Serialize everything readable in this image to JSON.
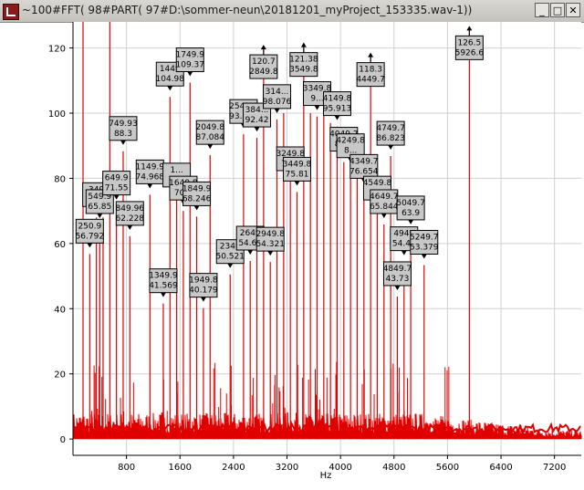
{
  "window": {
    "title": "~100#FFT( 98#PART( 97#D:\\sommer-neun\\20181201_myProject_153335.wav-1))",
    "minimize_glyph": "_",
    "maximize_glyph": "□",
    "close_glyph": "✕"
  },
  "colors": {
    "signal": "#e00000",
    "grid": "#d0d0d0",
    "label_bg": "#c8c8c8"
  },
  "chart_data": {
    "type": "line",
    "xlabel": "Hz",
    "ylabel": "",
    "xlim": [
      0,
      7600
    ],
    "ylim": [
      -5,
      128
    ],
    "xticks": [
      800,
      1600,
      2400,
      3200,
      4000,
      4800,
      5600,
      6400,
      7200
    ],
    "yticks": [
      0,
      20,
      40,
      60,
      80,
      100,
      120
    ],
    "grid": true,
    "noise_floor_db": 8,
    "peaks": [
      {
        "x": 150,
        "y": 128
      },
      {
        "x": 250,
        "y": 56.792
      },
      {
        "x": 350,
        "y": 68
      },
      {
        "x": 400,
        "y": 65.85
      },
      {
        "x": 450,
        "y": 68
      },
      {
        "x": 550,
        "y": 128
      },
      {
        "x": 650,
        "y": 71.55
      },
      {
        "x": 750,
        "y": 88.3
      },
      {
        "x": 850,
        "y": 62.228
      },
      {
        "x": 1150,
        "y": 74.968
      },
      {
        "x": 1350,
        "y": 41.569
      },
      {
        "x": 1450,
        "y": 104.98
      },
      {
        "x": 1550,
        "y": 74
      },
      {
        "x": 1650,
        "y": 70
      },
      {
        "x": 1750,
        "y": 109.37
      },
      {
        "x": 1850,
        "y": 68.246
      },
      {
        "x": 1950,
        "y": 40.179
      },
      {
        "x": 2050,
        "y": 87.084
      },
      {
        "x": 2350,
        "y": 50.521
      },
      {
        "x": 2550,
        "y": 93.519
      },
      {
        "x": 2650,
        "y": 54.64
      },
      {
        "x": 2750,
        "y": 92.42
      },
      {
        "x": 2850,
        "y": 120.7
      },
      {
        "x": 2950,
        "y": 54.321
      },
      {
        "x": 3050,
        "y": 98.076
      },
      {
        "x": 3150,
        "y": 100
      },
      {
        "x": 3250,
        "y": 79
      },
      {
        "x": 3350,
        "y": 75.81
      },
      {
        "x": 3450,
        "y": 121.38
      },
      {
        "x": 3550,
        "y": 100
      },
      {
        "x": 3650,
        "y": 99
      },
      {
        "x": 3750,
        "y": 101
      },
      {
        "x": 3850,
        "y": 97
      },
      {
        "x": 3950,
        "y": 95.913
      },
      {
        "x": 4050,
        "y": 85
      },
      {
        "x": 4150,
        "y": 83
      },
      {
        "x": 4250,
        "y": 80
      },
      {
        "x": 4350,
        "y": 76.654
      },
      {
        "x": 4450,
        "y": 118.3
      },
      {
        "x": 4550,
        "y": 70
      },
      {
        "x": 4650,
        "y": 65.844
      },
      {
        "x": 4750,
        "y": 86.823
      },
      {
        "x": 4850,
        "y": 43.73
      },
      {
        "x": 4950,
        "y": 54.46
      },
      {
        "x": 5050,
        "y": 63.9
      },
      {
        "x": 5250,
        "y": 53.379
      },
      {
        "x": 5926.6,
        "y": 126.5
      }
    ],
    "annotations": [
      {
        "x": 250,
        "y": 56.792,
        "lines": [
          "250.9",
          "56.792"
        ]
      },
      {
        "x": 350,
        "y": 68,
        "lines": [
          "349",
          "66"
        ]
      },
      {
        "x": 400,
        "y": 65.85,
        "lines": [
          "549.9",
          "65.85"
        ]
      },
      {
        "x": 650,
        "y": 71.55,
        "lines": [
          "649.9",
          "71.55"
        ]
      },
      {
        "x": 750,
        "y": 88.3,
        "lines": [
          "749.93",
          "88.3"
        ]
      },
      {
        "x": 850,
        "y": 62.228,
        "lines": [
          "849.96",
          "62.228"
        ]
      },
      {
        "x": 1150,
        "y": 74.968,
        "lines": [
          "1149.9",
          "74.968"
        ]
      },
      {
        "x": 1350,
        "y": 41.569,
        "lines": [
          "1349.9",
          "41.569"
        ]
      },
      {
        "x": 1450,
        "y": 104.98,
        "lines": [
          "1449",
          "104.98"
        ]
      },
      {
        "x": 1550,
        "y": 74,
        "lines": [
          "1...",
          "7..."
        ]
      },
      {
        "x": 1650,
        "y": 70,
        "lines": [
          "1649.8",
          "70..."
        ]
      },
      {
        "x": 1750,
        "y": 109.37,
        "lines": [
          "1749.9",
          "109.37"
        ]
      },
      {
        "x": 1850,
        "y": 68.246,
        "lines": [
          "1849.9",
          "68.246"
        ]
      },
      {
        "x": 1950,
        "y": 40.179,
        "lines": [
          "1949.8",
          "40.179"
        ]
      },
      {
        "x": 2050,
        "y": 87.084,
        "lines": [
          "2049.8",
          "87.084"
        ]
      },
      {
        "x": 2350,
        "y": 50.521,
        "lines": [
          "2349",
          "50.521"
        ]
      },
      {
        "x": 2550,
        "y": 93.519,
        "lines": [
          "2549.9",
          "93.519"
        ]
      },
      {
        "x": 2650,
        "y": 54.64,
        "lines": [
          "2649",
          "54.64"
        ]
      },
      {
        "x": 2750,
        "y": 92.42,
        "lines": [
          "384...",
          "92.42"
        ]
      },
      {
        "x": 2850,
        "y": 120.7,
        "lines": [
          "120.7",
          "2849.8"
        ]
      },
      {
        "x": 2950,
        "y": 54.321,
        "lines": [
          "2949.8",
          "54.321"
        ]
      },
      {
        "x": 3050,
        "y": 98.076,
        "lines": [
          "314...",
          "98.076"
        ]
      },
      {
        "x": 3250,
        "y": 79,
        "lines": [
          "3249.8",
          "79..."
        ]
      },
      {
        "x": 3350,
        "y": 75.81,
        "lines": [
          "3449.8",
          "75.81"
        ]
      },
      {
        "x": 3450,
        "y": 121.38,
        "lines": [
          "121.38",
          "3549.8"
        ]
      },
      {
        "x": 3650,
        "y": 99,
        "lines": [
          "3349.8",
          "9..."
        ]
      },
      {
        "x": 3950,
        "y": 95.913,
        "lines": [
          "4149.8",
          "95.913"
        ]
      },
      {
        "x": 4050,
        "y": 85,
        "lines": [
          "4049.7",
          "85..."
        ]
      },
      {
        "x": 4150,
        "y": 83,
        "lines": [
          "4249.8",
          "8..."
        ]
      },
      {
        "x": 4350,
        "y": 76.654,
        "lines": [
          "4349.7",
          "76.654"
        ]
      },
      {
        "x": 4450,
        "y": 118.3,
        "lines": [
          "118.3",
          "4449.7"
        ]
      },
      {
        "x": 4550,
        "y": 70,
        "lines": [
          "4549.8",
          "6..."
        ]
      },
      {
        "x": 4650,
        "y": 65.844,
        "lines": [
          "4649.7",
          "65.844"
        ]
      },
      {
        "x": 4750,
        "y": 86.823,
        "lines": [
          "4749.7",
          "86.823"
        ]
      },
      {
        "x": 4850,
        "y": 43.73,
        "lines": [
          "4849.7",
          "43.73"
        ]
      },
      {
        "x": 4950,
        "y": 54.46,
        "lines": [
          "4949",
          "54.46"
        ]
      },
      {
        "x": 5050,
        "y": 63.9,
        "lines": [
          "5049.7",
          "63.9"
        ]
      },
      {
        "x": 5250,
        "y": 53.379,
        "lines": [
          "5249.7",
          "53.379"
        ]
      },
      {
        "x": 5926.6,
        "y": 126.5,
        "lines": [
          "126.5",
          "5926.6"
        ]
      }
    ]
  }
}
